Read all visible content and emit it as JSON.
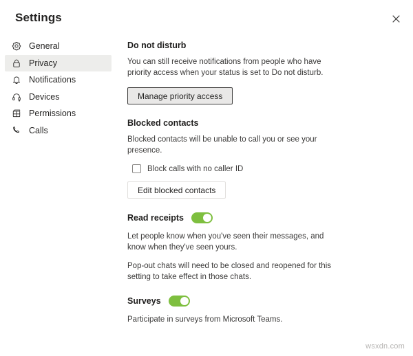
{
  "window": {
    "title": "Settings",
    "close_icon": "close-icon"
  },
  "sidebar": {
    "items": [
      {
        "label": "General",
        "icon": "gear-icon",
        "selected": false
      },
      {
        "label": "Privacy",
        "icon": "lock-icon",
        "selected": true
      },
      {
        "label": "Notifications",
        "icon": "bell-icon",
        "selected": false
      },
      {
        "label": "Devices",
        "icon": "headset-icon",
        "selected": false
      },
      {
        "label": "Permissions",
        "icon": "app-grid-icon",
        "selected": false
      },
      {
        "label": "Calls",
        "icon": "phone-icon",
        "selected": false
      }
    ]
  },
  "main": {
    "do_not_disturb": {
      "heading": "Do not disturb",
      "description": "You can still receive notifications from people who have priority access when your status is set to Do not disturb.",
      "button_label": "Manage priority access"
    },
    "blocked_contacts": {
      "heading": "Blocked contacts",
      "description": "Blocked contacts will be unable to call you or see your presence.",
      "checkbox_label": "Block calls with no caller ID",
      "checkbox_checked": false,
      "button_label": "Edit blocked contacts"
    },
    "read_receipts": {
      "heading": "Read receipts",
      "toggle_on": true,
      "description_1": "Let people know when you've seen their messages, and know when they've seen yours.",
      "description_2": "Pop-out chats will need to be closed and reopened for this setting to take effect in those chats."
    },
    "surveys": {
      "heading": "Surveys",
      "toggle_on": true,
      "description": "Participate in surveys from Microsoft Teams."
    }
  },
  "watermark": {
    "text": "wsxdn.com"
  },
  "colors": {
    "toggle_on": "#7ebf3f",
    "selected_item_bg": "#ededeb",
    "text_primary": "#252423",
    "text_secondary": "#3b3a39"
  }
}
